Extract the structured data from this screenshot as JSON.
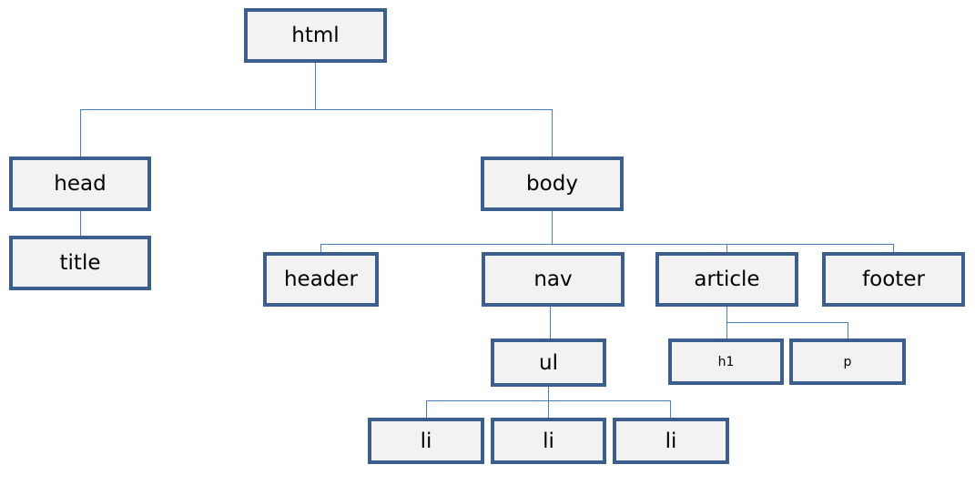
{
  "nodes": {
    "html": "html",
    "head": "head",
    "title": "title",
    "body": "body",
    "header": "header",
    "nav": "nav",
    "article": "article",
    "footer": "footer",
    "ul": "ul",
    "li1": "li",
    "li2": "li",
    "li3": "li",
    "h1": "h1",
    "p": "p"
  },
  "colors": {
    "box_border": "#3b5e8c",
    "box_fill": "#f2f2f2",
    "connector": "#4a7ebb"
  }
}
